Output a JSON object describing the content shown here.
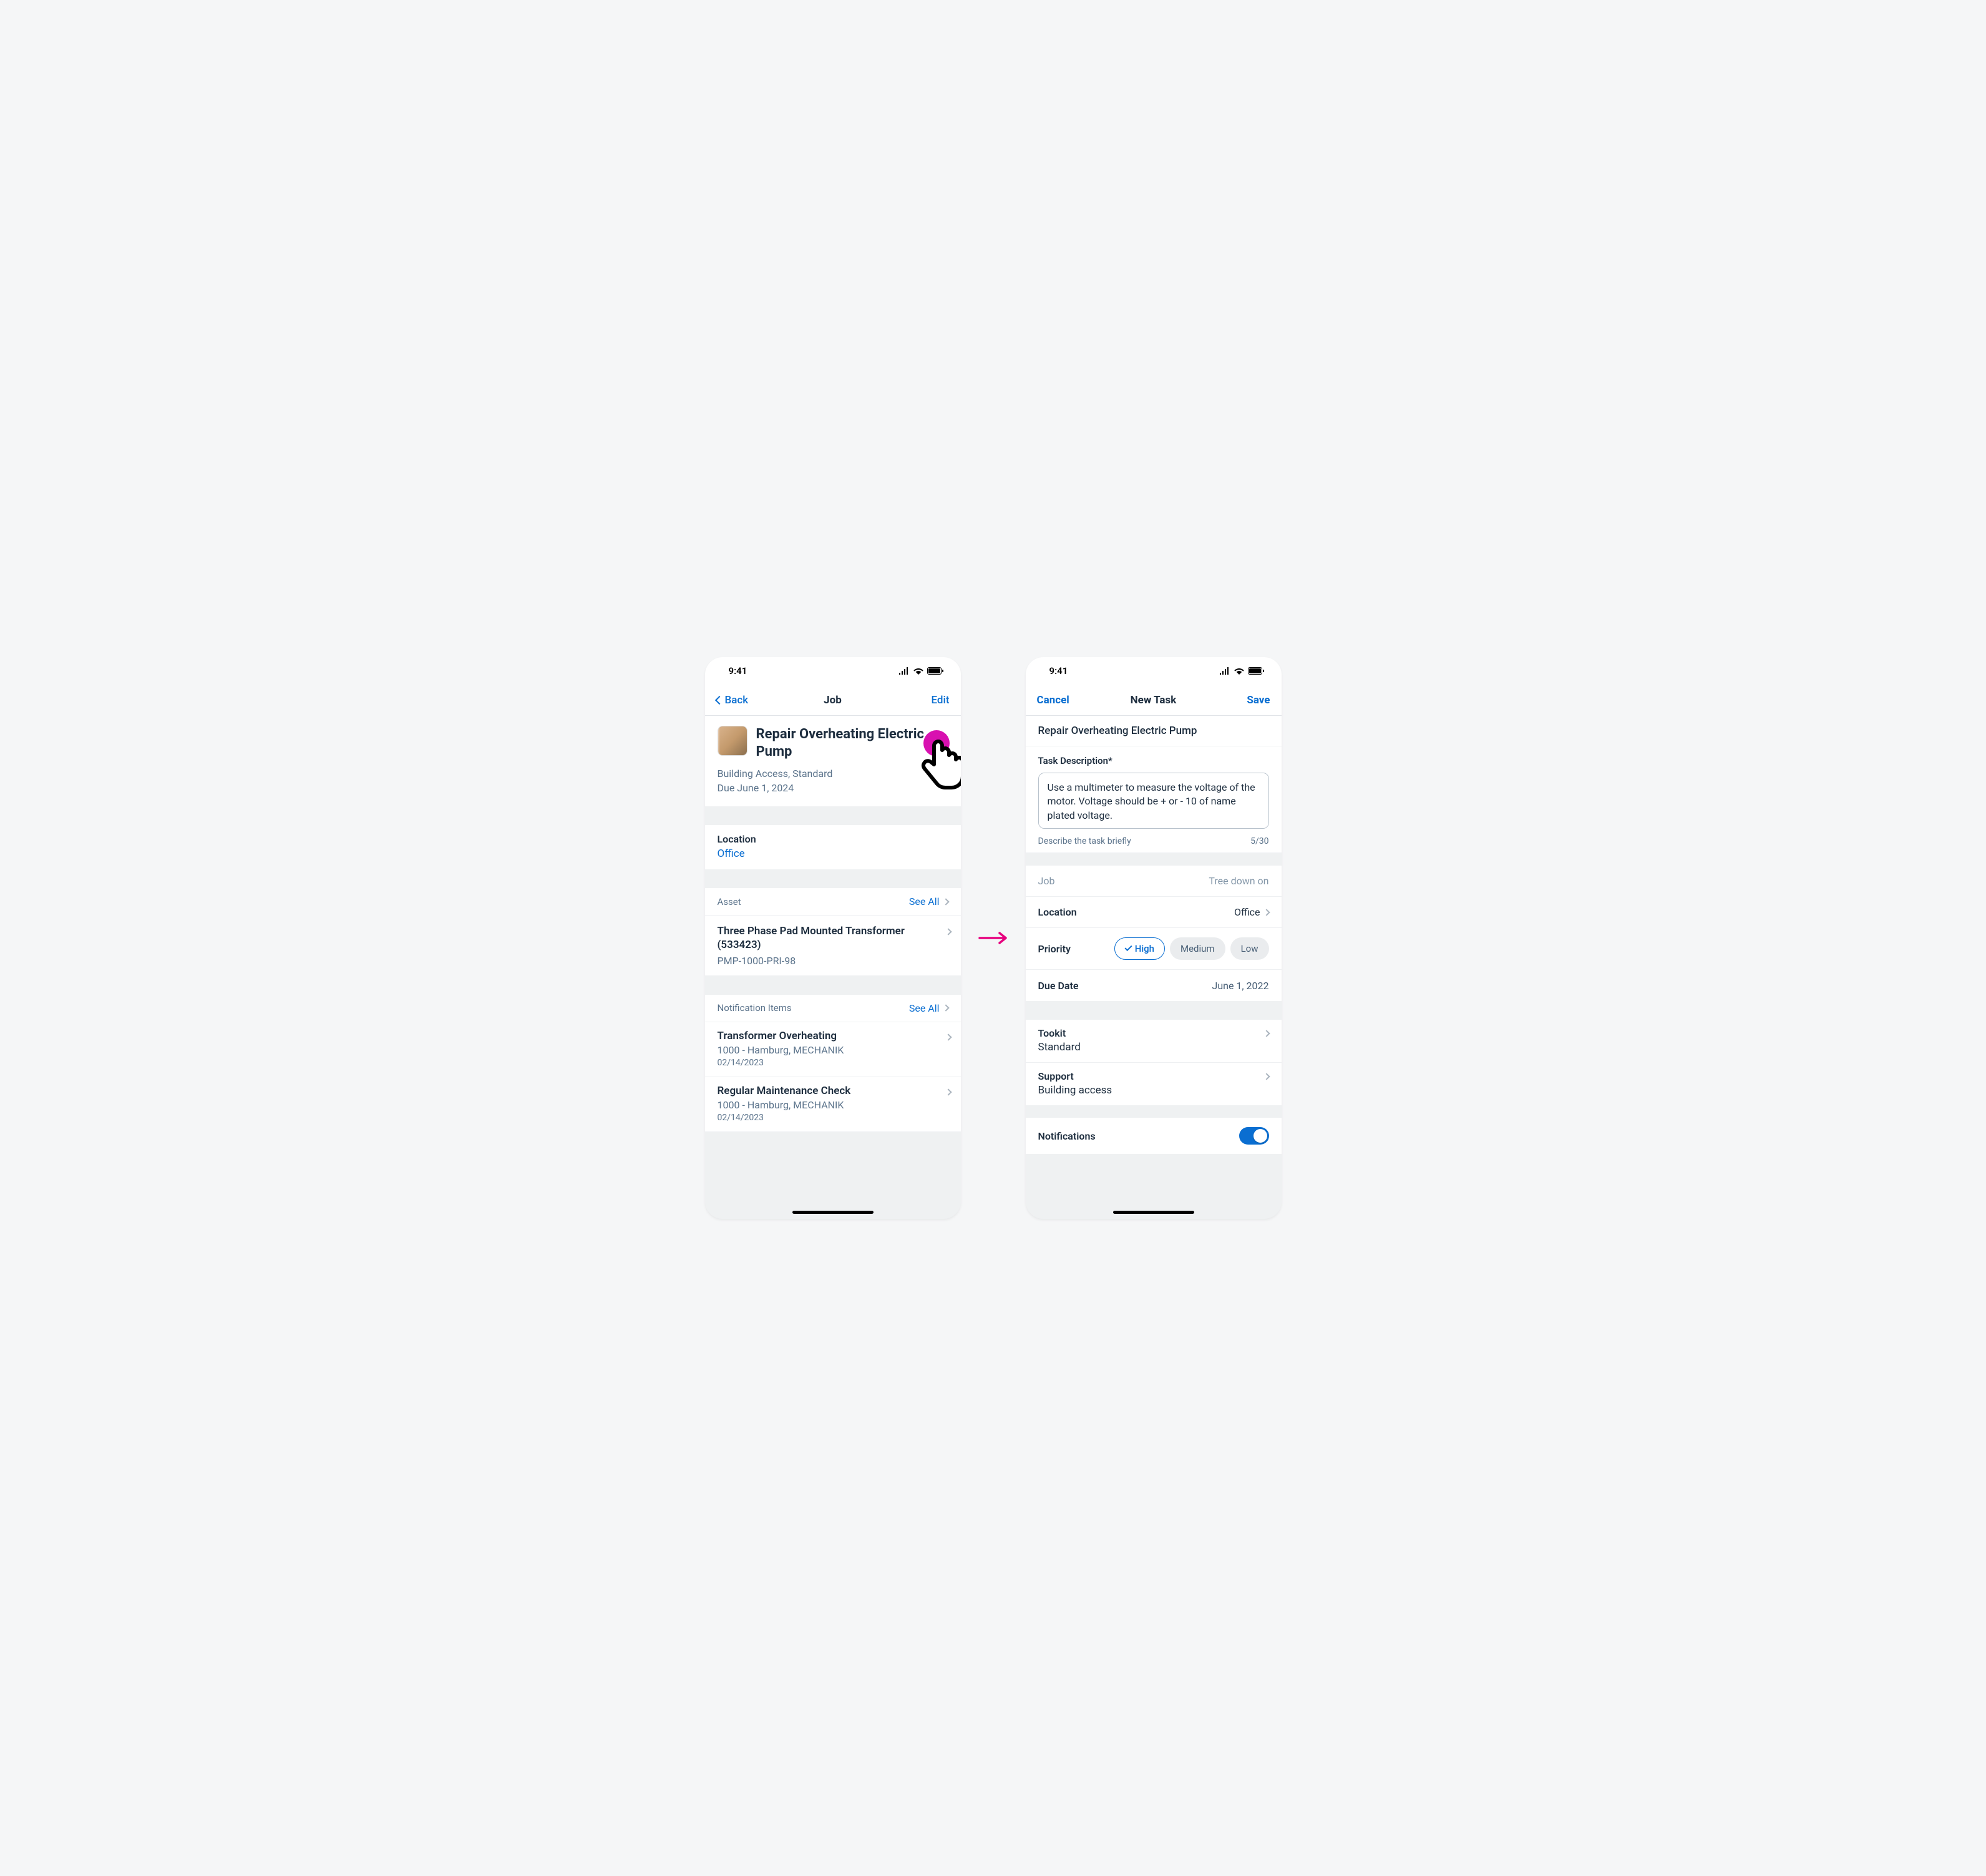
{
  "status": {
    "time": "9:41"
  },
  "left": {
    "nav": {
      "back": "Back",
      "title": "Job",
      "edit": "Edit"
    },
    "job": {
      "title": "Repair Overheating Electric Pump",
      "tags": "Building Access, Standard",
      "due": "Due June 1, 2024"
    },
    "location": {
      "label": "Location",
      "value": "Office"
    },
    "asset": {
      "header": "Asset",
      "see_all": "See All",
      "name": "Three Phase Pad Mounted Transformer (533423)",
      "code": "PMP-1000-PRI-98"
    },
    "notifications": {
      "header": "Notification Items",
      "see_all": "See All",
      "items": [
        {
          "title": "Transformer Overheating",
          "sub": "1000 - Hamburg, MECHANIK",
          "date": "02/14/2023"
        },
        {
          "title": "Regular Maintenance Check",
          "sub": "1000 - Hamburg, MECHANIK",
          "date": "02/14/2023"
        }
      ]
    }
  },
  "right": {
    "nav": {
      "cancel": "Cancel",
      "title": "New Task",
      "save": "Save"
    },
    "title": "Repair Overheating Electric Pump",
    "desc": {
      "label": "Task Description*",
      "value": "Use a multimeter to measure the voltage of the motor. Voltage should be + or - 10 of name plated voltage.",
      "helper": "Describe the task briefly",
      "counter": "5/30"
    },
    "job_row": {
      "label": "Job",
      "value": "Tree down on"
    },
    "location_row": {
      "label": "Location",
      "value": "Office"
    },
    "priority": {
      "label": "Priority",
      "high": "High",
      "medium": "Medium",
      "low": "Low"
    },
    "due": {
      "label": "Due Date",
      "value": "June 1, 2022"
    },
    "toolkit": {
      "label": "Tookit",
      "value": "Standard"
    },
    "support": {
      "label": "Support",
      "value": "Building access"
    },
    "notifications": {
      "label": "Notifications"
    }
  }
}
